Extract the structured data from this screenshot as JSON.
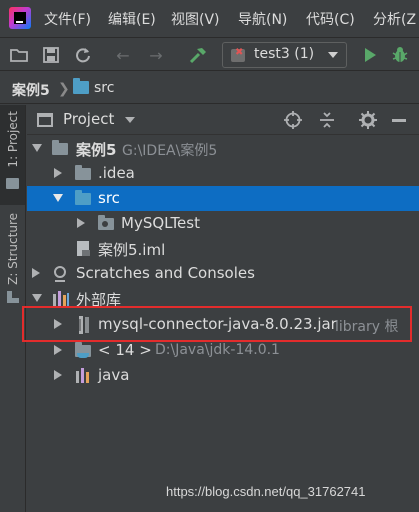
{
  "menu": {
    "items": [
      {
        "label": "文件(F)"
      },
      {
        "label": "编辑(E)"
      },
      {
        "label": "视图(V)"
      },
      {
        "label": "导航(N)"
      },
      {
        "label": "代码(C)"
      },
      {
        "label": "分析(Z"
      }
    ]
  },
  "toolbar": {
    "run_config": "test3 (1)",
    "icons": [
      "open-folder-icon",
      "save-icon",
      "sync-icon",
      "back-icon",
      "forward-icon",
      "build-hammer-icon",
      "run-icon",
      "debug-icon"
    ]
  },
  "breadcrumb": {
    "project": "案例5",
    "folder": "src"
  },
  "stripe": {
    "project_tab": "1: Project",
    "structure_tab": "Z: Structure"
  },
  "panel": {
    "title": "Project"
  },
  "tree": {
    "root": {
      "name": "案例5",
      "path": "G:\\IDEA\\案例5"
    },
    "idea": ".idea",
    "src": "src",
    "mysqltest": "MySQLTest",
    "iml": "案例5.iml",
    "scratches": "Scratches and Consoles",
    "external": "外部库",
    "jar": {
      "name": "mysql-connector-java-8.0.23.jar",
      "suffix": "library 根"
    },
    "jdk": {
      "name": "< 14 >",
      "path": "D:\\Java\\jdk-14.0.1"
    },
    "java": "java"
  },
  "watermark": "https://blog.csdn.net/qq_31762741",
  "colors": {
    "background": "#3c3f41",
    "selection": "#0d6dc3",
    "highlight_border": "#e32c2c",
    "folder_blue": "#4e9ec6",
    "run_green": "#59a869"
  }
}
